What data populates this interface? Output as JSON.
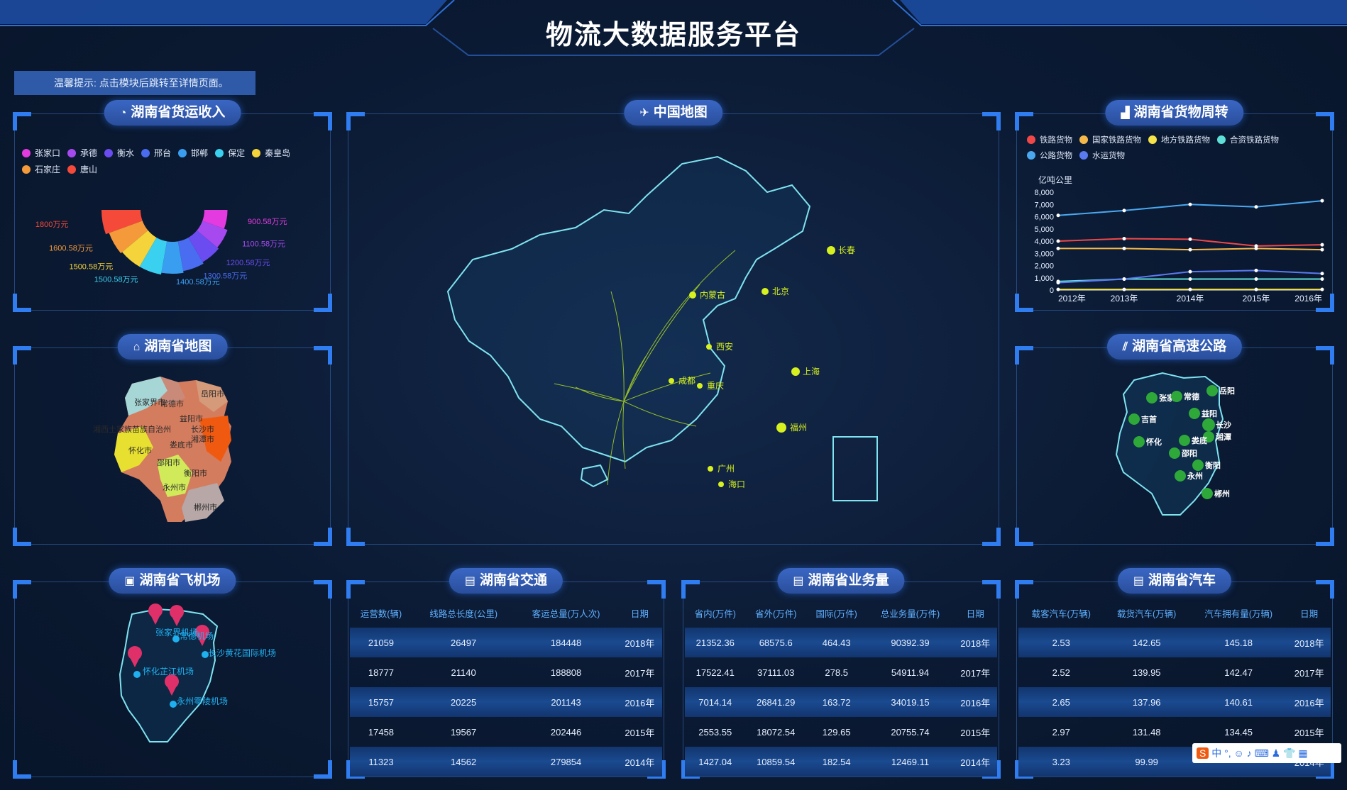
{
  "header": {
    "title": "物流大数据服务平台"
  },
  "tip": {
    "text": "温馨提示: 点击模块后跳转至详情页面。"
  },
  "panels": {
    "revenue": {
      "title": "湖南省货运收入"
    },
    "china_map": {
      "title": "中国地图"
    },
    "freight_turnover": {
      "title": "湖南省货物周转"
    },
    "hunan_map": {
      "title": "湖南省地图"
    },
    "highway": {
      "title": "湖南省高速公路"
    },
    "airport": {
      "title": "湖南省飞机场"
    },
    "traffic": {
      "title": "湖南省交通"
    },
    "business": {
      "title": "湖南省业务量"
    },
    "auto": {
      "title": "湖南省汽车"
    }
  },
  "revenue_legend": [
    {
      "name": "张家口",
      "color": "#e33be0"
    },
    {
      "name": "承德",
      "color": "#a64af0"
    },
    {
      "name": "衡水",
      "color": "#6a4cf0"
    },
    {
      "name": "邢台",
      "color": "#4a6cf0"
    },
    {
      "name": "邯郸",
      "color": "#3a9ef0"
    },
    {
      "name": "保定",
      "color": "#3ad0f0"
    },
    {
      "name": "秦皇岛",
      "color": "#f5d33a"
    },
    {
      "name": "石家庄",
      "color": "#f59a3a"
    },
    {
      "name": "唐山",
      "color": "#f54a3a"
    }
  ],
  "chart_data": [
    {
      "type": "pie",
      "labels": [
        "1800万元",
        "1600.58万元",
        "1500.58万元",
        "1500.58万元",
        "1400.58万元",
        "1300.58万元",
        "1200.58万元",
        "1100.58万元",
        "900.58万元"
      ],
      "values": [
        1800,
        1600.58,
        1500.58,
        1500.58,
        1400.58,
        1300.58,
        1200.58,
        1100.58,
        900.58
      ],
      "colors": [
        "#f54a3a",
        "#f59a3a",
        "#f5d33a",
        "#3ad0f0",
        "#3a9ef0",
        "#4a6cf0",
        "#6a4cf0",
        "#a64af0",
        "#e33be0"
      ]
    },
    {
      "type": "line",
      "ylabel": "亿吨公里",
      "x": [
        "2012年",
        "2013年",
        "2014年",
        "2015年",
        "2016年"
      ],
      "ylim": [
        0,
        8000
      ],
      "yticks": [
        "8,000",
        "7,000",
        "6,000",
        "5,000",
        "4,000",
        "3,000",
        "2,000",
        "1,000",
        "0"
      ],
      "series": [
        {
          "name": "铁路货物",
          "color": "#f04848",
          "values": [
            4000,
            4200,
            4150,
            3600,
            3700
          ]
        },
        {
          "name": "国家铁路货物",
          "color": "#f5b84a",
          "values": [
            3400,
            3400,
            3300,
            3400,
            3300
          ]
        },
        {
          "name": "地方铁路货物",
          "color": "#f5e34a",
          "values": [
            50,
            50,
            50,
            50,
            50
          ]
        },
        {
          "name": "合资铁路货物",
          "color": "#5ee0d8",
          "values": [
            700,
            900,
            900,
            900,
            900
          ]
        },
        {
          "name": "公路货物",
          "color": "#4aa8f0",
          "values": [
            6100,
            6500,
            7000,
            6800,
            7300
          ]
        },
        {
          "name": "水运货物",
          "color": "#5a7af0",
          "values": [
            600,
            900,
            1500,
            1600,
            1350
          ]
        }
      ]
    }
  ],
  "china_cities": [
    "长春",
    "内蒙古",
    "北京",
    "西安",
    "上海",
    "成都",
    "重庆",
    "福州",
    "广州",
    "海口"
  ],
  "hunan_cities": [
    "岳阳市",
    "张家界市",
    "常德市",
    "益阳市",
    "湘西土家族苗族自治州",
    "长沙市",
    "湘潭市",
    "怀化市",
    "娄底市",
    "邵阳市",
    "衡阳市",
    "永州市",
    "郴州市"
  ],
  "highway_cities": [
    "岳阳",
    "张家",
    "常德",
    "益阳",
    "吉首",
    "长沙",
    "湘潭",
    "怀化",
    "娄底",
    "邵阳",
    "衡阳",
    "永州",
    "郴州"
  ],
  "airport_labels": [
    "常德机场",
    "张家界机场",
    "长沙黄花国际机场",
    "怀化芷江机场",
    "永州零陵机场"
  ],
  "traffic_table": {
    "headers": [
      "运营数(辆)",
      "线路总长度(公里)",
      "客运总量(万人次)",
      "日期"
    ],
    "rows": [
      [
        "21059",
        "26497",
        "184448",
        "2018年"
      ],
      [
        "18777",
        "21140",
        "188808",
        "2017年"
      ],
      [
        "15757",
        "20225",
        "201143",
        "2016年"
      ],
      [
        "17458",
        "19567",
        "202446",
        "2015年"
      ],
      [
        "11323",
        "14562",
        "279854",
        "2014年"
      ]
    ]
  },
  "business_table": {
    "headers": [
      "省内(万件)",
      "省外(万件)",
      "国际(万件)",
      "总业务量(万件)",
      "日期"
    ],
    "rows": [
      [
        "21352.36",
        "68575.6",
        "464.43",
        "90392.39",
        "2018年"
      ],
      [
        "17522.41",
        "37111.03",
        "278.5",
        "54911.94",
        "2017年"
      ],
      [
        "7014.14",
        "26841.29",
        "163.72",
        "34019.15",
        "2016年"
      ],
      [
        "2553.55",
        "18072.54",
        "129.65",
        "20755.74",
        "2015年"
      ],
      [
        "1427.04",
        "10859.54",
        "182.54",
        "12469.11",
        "2014年"
      ]
    ]
  },
  "auto_table": {
    "headers": [
      "载客汽车(万辆)",
      "载货汽车(万辆)",
      "汽车拥有量(万辆)",
      "日期"
    ],
    "rows": [
      [
        "2.53",
        "142.65",
        "145.18",
        "2018年"
      ],
      [
        "2.52",
        "139.95",
        "142.47",
        "2017年"
      ],
      [
        "2.65",
        "137.96",
        "140.61",
        "2016年"
      ],
      [
        "2.97",
        "131.48",
        "134.45",
        "2015年"
      ],
      [
        "3.23",
        "99.99",
        "",
        "2014年"
      ]
    ]
  },
  "ime": {
    "text": "中 °, ☺ ♪ ⌨ ♟ 👕 ▦"
  }
}
